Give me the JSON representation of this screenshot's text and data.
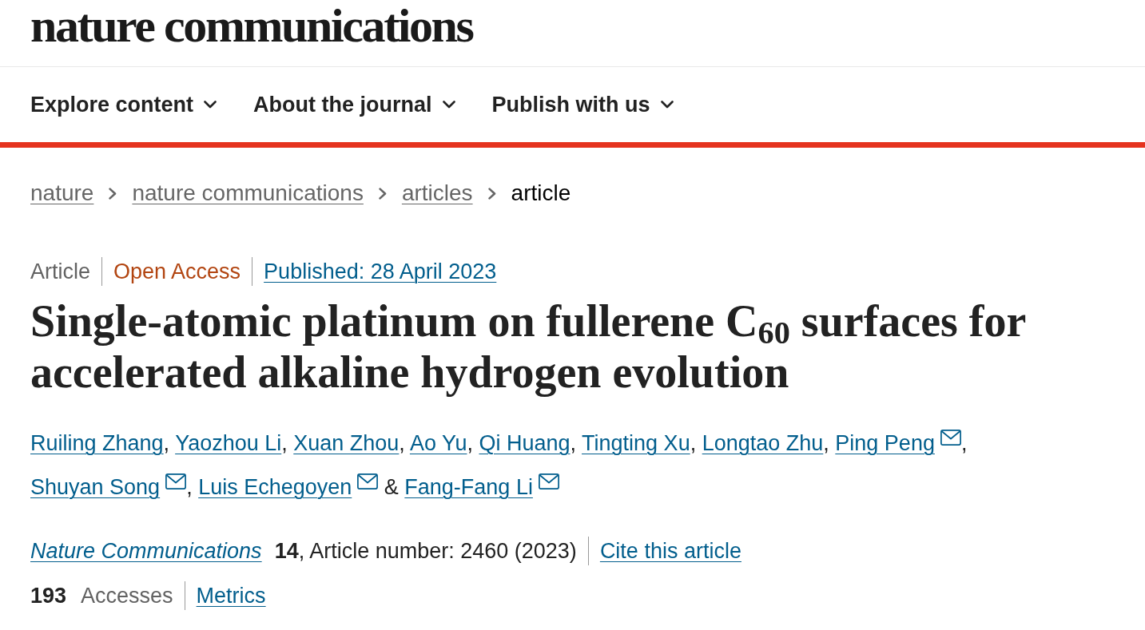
{
  "header": {
    "logo": "nature communications"
  },
  "nav": [
    {
      "label": "Explore content",
      "expanded": false
    },
    {
      "label": "About the journal",
      "expanded": false
    },
    {
      "label": "Publish with us",
      "expanded": false
    }
  ],
  "breadcrumb": [
    {
      "label": "nature",
      "current": false
    },
    {
      "label": "nature communications",
      "current": false
    },
    {
      "label": "articles",
      "current": false
    },
    {
      "label": "article",
      "current": true
    }
  ],
  "article": {
    "meta": [
      {
        "kind": "type",
        "text": "Article"
      },
      {
        "kind": "access",
        "text": "Open Access"
      },
      {
        "kind": "date",
        "text": "Published: 28 April 2023"
      }
    ],
    "title": "Single-atomic platinum on fullerene C$_{60}$ surfaces for accelerated alkaline hydrogen evolution",
    "authors": [
      {
        "name": "Ruiling Zhang",
        "email": false,
        "separator": ", "
      },
      {
        "name": "Yaozhou Li",
        "email": false,
        "separator": ", "
      },
      {
        "name": "Xuan Zhou",
        "email": false,
        "separator": ", "
      },
      {
        "name": "Ao Yu",
        "email": false,
        "separator": ", "
      },
      {
        "name": "Qi Huang",
        "email": false,
        "separator": ", "
      },
      {
        "name": "Tingting Xu",
        "email": false,
        "separator": ", "
      },
      {
        "name": "Longtao Zhu",
        "email": false,
        "separator": ", "
      },
      {
        "name": "Ping Peng",
        "email": true,
        "separator": ", "
      },
      {
        "name": "Shuyan Song",
        "email": true,
        "separator": ", "
      },
      {
        "name": "Luis Echegoyen",
        "email": true,
        "separator": " & "
      },
      {
        "name": "Fang-Fang Li",
        "email": true
      }
    ],
    "citation": {
      "journal": "Nature Communications",
      "details": "**14**, Article number: 2460 (2023)",
      "cite_link": "Cite this article"
    },
    "metrics": {
      "count": "193",
      "label": "Accesses",
      "link": "Metrics"
    }
  }
}
